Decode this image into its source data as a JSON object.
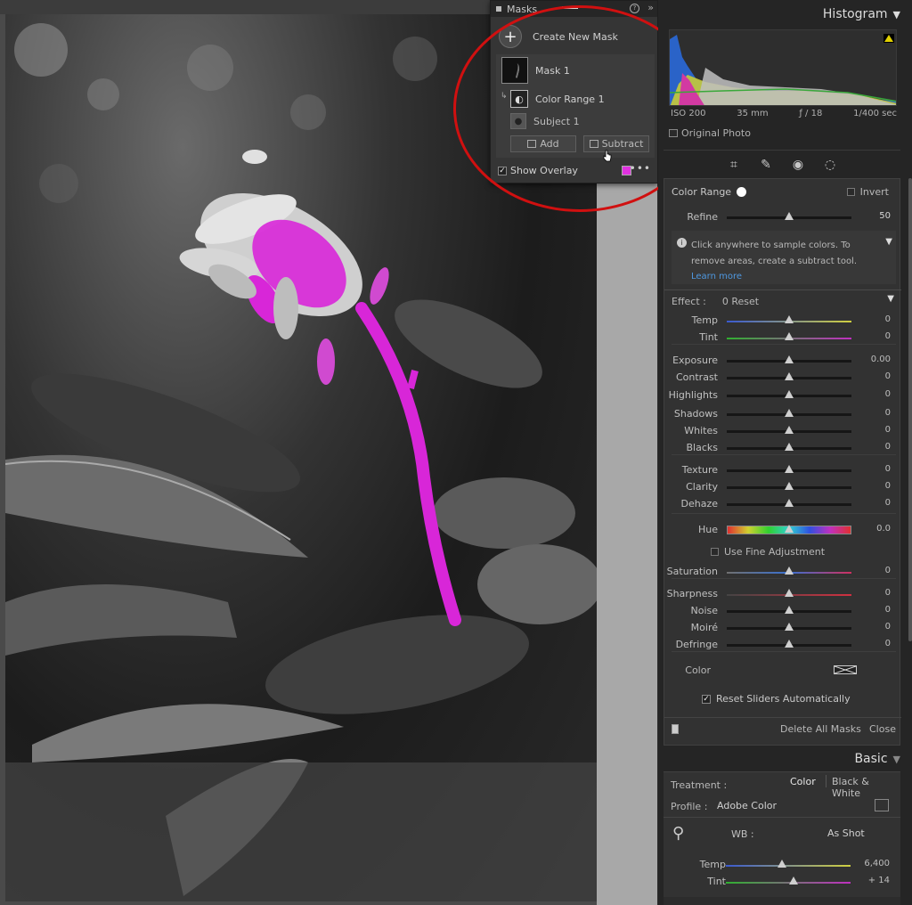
{
  "masks_panel": {
    "title": "Masks",
    "create_new": "Create New Mask",
    "mask1": "Mask 1",
    "color_range": "Color Range 1",
    "subject": "Subject 1",
    "add": "Add",
    "subtract": "Subtract",
    "show_overlay": "Show Overlay",
    "overlay_color": "#e032e0"
  },
  "histogram": {
    "title": "Histogram",
    "iso": "ISO 200",
    "focal": "35 mm",
    "aperture": "ƒ / 18",
    "shutter": "1/400 sec",
    "original_photo": "Original Photo"
  },
  "tools": [
    "crop-icon",
    "heal-icon",
    "redeye-icon",
    "mask-icon"
  ],
  "mask_settings": {
    "color_range_label": "Color Range",
    "invert": "Invert",
    "refine_label": "Refine",
    "refine_value": "50",
    "refine_fraction": 0.5,
    "hint": "Click anywhere to sample colors. To remove areas, create a subtract tool.",
    "learn_more": "Learn more",
    "effect_label": "Effect :",
    "effect_preset": "0 Reset",
    "sliders": [
      {
        "label": "Temp",
        "value": "0",
        "fraction": 0.5
      },
      {
        "label": "Tint",
        "value": "0",
        "fraction": 0.5
      },
      {
        "label": "Exposure",
        "value": "0.00",
        "fraction": 0.5
      },
      {
        "label": "Contrast",
        "value": "0",
        "fraction": 0.5
      },
      {
        "label": "Highlights",
        "value": "0",
        "fraction": 0.5
      },
      {
        "label": "Shadows",
        "value": "0",
        "fraction": 0.5
      },
      {
        "label": "Whites",
        "value": "0",
        "fraction": 0.5
      },
      {
        "label": "Blacks",
        "value": "0",
        "fraction": 0.5
      },
      {
        "label": "Texture",
        "value": "0",
        "fraction": 0.5
      },
      {
        "label": "Clarity",
        "value": "0",
        "fraction": 0.5
      },
      {
        "label": "Dehaze",
        "value": "0",
        "fraction": 0.5
      },
      {
        "label": "Hue",
        "value": "0.0",
        "fraction": 0.5
      },
      {
        "label": "Saturation",
        "value": "0",
        "fraction": 0.5
      },
      {
        "label": "Sharpness",
        "value": "0",
        "fraction": 0.5
      },
      {
        "label": "Noise",
        "value": "0",
        "fraction": 0.5
      },
      {
        "label": "Moiré",
        "value": "0",
        "fraction": 0.5
      },
      {
        "label": "Defringe",
        "value": "0",
        "fraction": 0.5
      }
    ],
    "fine_adjustment": "Use Fine Adjustment",
    "color_label": "Color",
    "reset_sliders": "Reset Sliders Automatically",
    "delete_all": "Delete All Masks",
    "close": "Close"
  },
  "basic": {
    "title": "Basic",
    "treatment_label": "Treatment :",
    "color": "Color",
    "bw": "Black & White",
    "profile_label": "Profile :",
    "profile_value": "Adobe Color",
    "wb_label": "WB :",
    "wb_value": "As Shot",
    "temp_label": "Temp",
    "temp_value": "6,400",
    "temp_fraction": 0.45,
    "tint_label": "Tint",
    "tint_value": "+ 14",
    "tint_fraction": 0.54
  }
}
